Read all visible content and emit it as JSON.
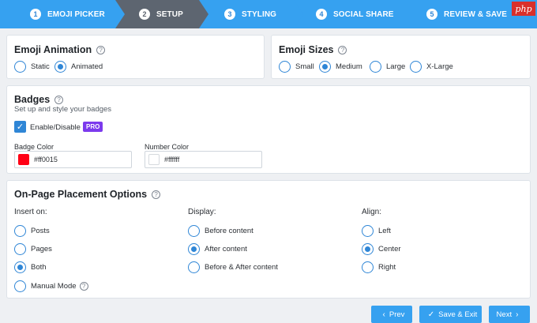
{
  "stepper": {
    "steps": [
      {
        "num": "1",
        "label": "EMOJI PICKER"
      },
      {
        "num": "2",
        "label": "SETUP"
      },
      {
        "num": "3",
        "label": "STYLING"
      },
      {
        "num": "4",
        "label": "SOCIAL SHARE"
      },
      {
        "num": "5",
        "label": "REVIEW & SAVE"
      }
    ],
    "active_step": "2"
  },
  "watermark": "php",
  "emoji_animation": {
    "title": "Emoji Animation",
    "options": [
      "Static",
      "Animated"
    ],
    "selected": "Animated"
  },
  "emoji_sizes": {
    "title": "Emoji Sizes",
    "options": [
      "Small",
      "Medium",
      "Large",
      "X-Large"
    ],
    "selected": "Medium"
  },
  "badges": {
    "title": "Badges",
    "subtitle": "Set up and style your badges",
    "enable_label": "Enable/Disable",
    "pro_label": "PRO",
    "enabled": true,
    "badge_color_label": "Badge Color",
    "badge_color_value": "#ff0015",
    "number_color_label": "Number Color",
    "number_color_value": "#ffffff"
  },
  "placement": {
    "title": "On-Page Placement Options",
    "insert_on": {
      "label": "Insert on:",
      "options": [
        "Posts",
        "Pages",
        "Both",
        "Manual Mode"
      ],
      "selected": "Both"
    },
    "display": {
      "label": "Display:",
      "options": [
        "Before content",
        "After content",
        "Before & After content"
      ],
      "selected": "After content"
    },
    "align": {
      "label": "Align:",
      "options": [
        "Left",
        "Center",
        "Right"
      ],
      "selected": "Center"
    }
  },
  "footer": {
    "prev_label": "Prev",
    "save_exit_label": "Save & Exit",
    "next_label": "Next"
  },
  "colors": {
    "accent": "#36a1f0",
    "active_step": "#5d6570",
    "pro": "#7c3aed"
  }
}
